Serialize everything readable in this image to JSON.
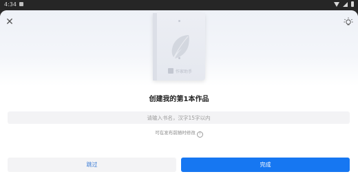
{
  "status_bar": {
    "time": "4:34",
    "icons": [
      "notification-icon",
      "wifi-icon",
      "signal-icon",
      "battery-icon"
    ]
  },
  "header": {
    "close_icon": "close-icon",
    "tip_icon": "lightbulb-icon"
  },
  "cover": {
    "brand_text": "作家助手"
  },
  "form": {
    "title": "创建我的第1本作品",
    "book_name_value": "",
    "book_name_placeholder": "请输入书名，汉字15字以内",
    "hint": "可在发布前随时修改"
  },
  "actions": {
    "skip_label": "跳过",
    "done_label": "完成"
  },
  "colors": {
    "primary": "#1677f2",
    "skip_text": "#3a7bd5",
    "input_bg": "#f3f3f5"
  }
}
